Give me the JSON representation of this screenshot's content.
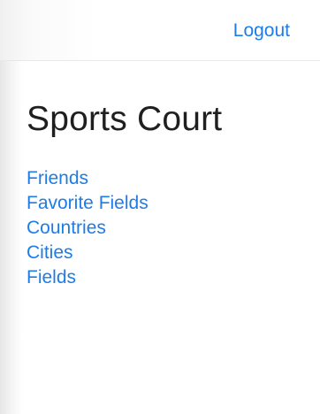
{
  "header": {
    "logout_label": "Logout"
  },
  "main": {
    "title": "Sports Court",
    "links": [
      {
        "label": "Friends"
      },
      {
        "label": "Favorite Fields"
      },
      {
        "label": "Countries"
      },
      {
        "label": "Cities"
      },
      {
        "label": "Fields"
      }
    ]
  },
  "colors": {
    "link": "#1e7ce6",
    "title": "#1f1f1f"
  }
}
